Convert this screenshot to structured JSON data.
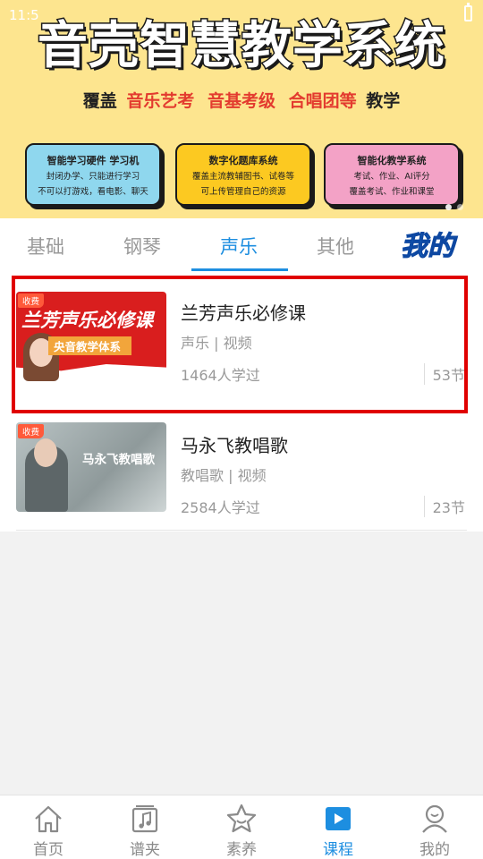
{
  "status": {
    "time": "11:5"
  },
  "banner": {
    "title": "音壳智慧教学系统",
    "coverage": {
      "prefix": "覆盖",
      "items": [
        "音乐艺考",
        "音基考级",
        "合唱团等"
      ],
      "suffix": "教学"
    },
    "features": [
      {
        "title": "智能学习硬件 学习机",
        "lines": [
          "封闭办学、只能进行学习",
          "不可以打游戏，看电影、聊天"
        ],
        "color": "#8fd7ee"
      },
      {
        "title": "数字化题库系统",
        "lines": [
          "覆盖主流教辅图书、试卷等",
          "可上传管理自己的资源"
        ],
        "color": "#fcc921"
      },
      {
        "title": "智能化教学系统",
        "lines": [
          "考试、作业、AI评分",
          "覆盖考试、作业和课堂"
        ],
        "color": "#f3a2c6"
      }
    ]
  },
  "tabs": [
    {
      "label": "基础",
      "active": false
    },
    {
      "label": "钢琴",
      "active": false
    },
    {
      "label": "声乐",
      "active": true
    },
    {
      "label": "其他",
      "active": false
    },
    {
      "label": "我的",
      "active": false
    }
  ],
  "courses": [
    {
      "badge": "收费",
      "thumb_title": "兰芳声乐必修课",
      "thumb_subtitle": "央音教学体系",
      "title": "兰芳声乐必修课",
      "tags": "声乐 | 视频",
      "learners": "1464人学过",
      "lessons": "53节"
    },
    {
      "badge": "收费",
      "thumb_title": "马永飞教唱歌",
      "title": "马永飞教唱歌",
      "tags": "教唱歌 | 视频",
      "learners": "2584人学过",
      "lessons": "23节"
    }
  ],
  "bottom_nav": [
    {
      "label": "首页",
      "icon": "home-icon",
      "active": false
    },
    {
      "label": "谱夹",
      "icon": "music-folder-icon",
      "active": false
    },
    {
      "label": "素养",
      "icon": "star-icon",
      "active": false
    },
    {
      "label": "课程",
      "icon": "play-icon",
      "active": true
    },
    {
      "label": "我的",
      "icon": "user-icon",
      "active": false
    }
  ],
  "colors": {
    "accent": "#1d8ee0",
    "highlight": "#e00000",
    "badge": "#ff5a3a"
  }
}
